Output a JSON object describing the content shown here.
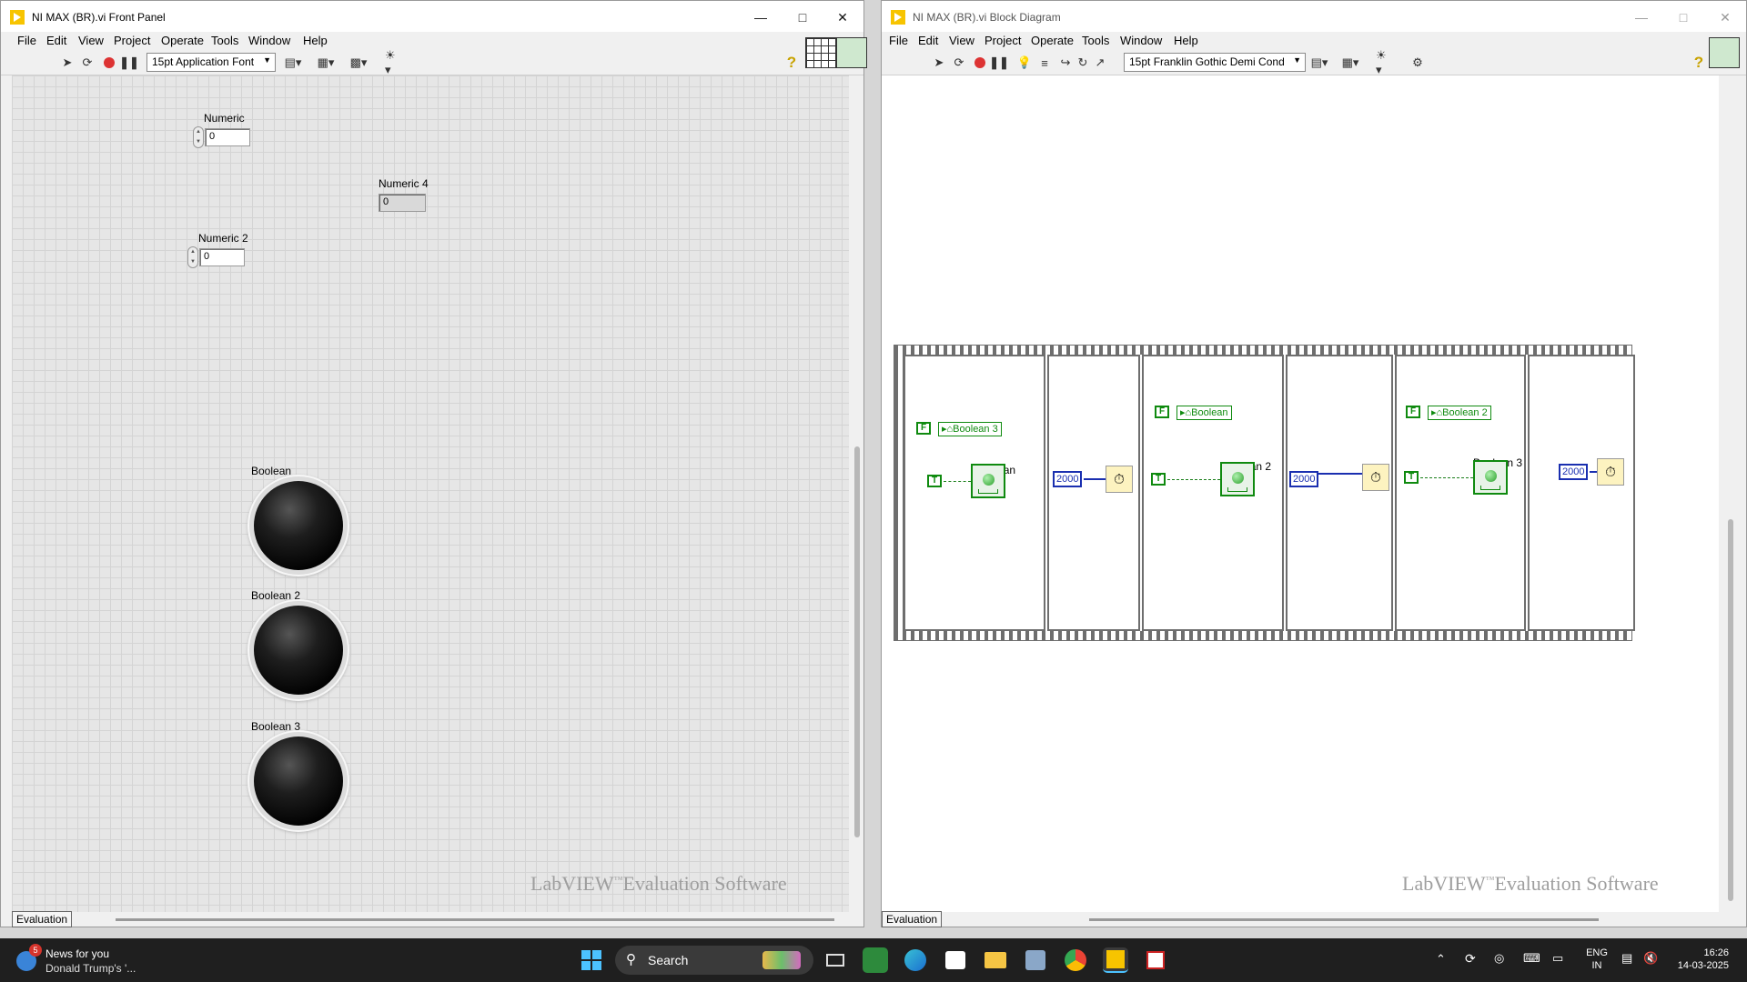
{
  "front_panel": {
    "title": "NI MAX (BR).vi Front Panel",
    "menu": [
      "File",
      "Edit",
      "View",
      "Project",
      "Operate",
      "Tools",
      "Window",
      "Help"
    ],
    "font_select": "15pt Application Font",
    "controls": [
      {
        "label": "Numeric",
        "value": "0"
      },
      {
        "label": "Numeric 2",
        "value": "0"
      }
    ],
    "indicator": {
      "label": "Numeric 4",
      "value": "0"
    },
    "leds": [
      "Boolean",
      "Boolean 2",
      "Boolean 3"
    ],
    "watermark_main": "LabVIEW",
    "watermark_tm": "™",
    "watermark_rest": "Evaluation Software",
    "eval_tab": "Evaluation"
  },
  "block_diagram": {
    "title": "NI MAX (BR).vi Block Diagram",
    "menu": [
      "File",
      "Edit",
      "View",
      "Project",
      "Operate",
      "Tools",
      "Window",
      "Help"
    ],
    "font_select": "15pt Franklin Gothic Demi Cond",
    "const_true": "T",
    "const_false": "F",
    "locals": [
      "Boolean 3",
      "Boolean",
      "Boolean 2"
    ],
    "terminals": [
      "Boolean",
      "Boolean 2",
      "Boolean 3"
    ],
    "wait_value": "2000",
    "watermark_main": "LabVIEW",
    "watermark_tm": "™",
    "watermark_rest": "Evaluation Software",
    "eval_tab": "Evaluation"
  },
  "taskbar": {
    "news_title": "News for you",
    "news_sub": "Donald Trump's '...",
    "news_badge": "5",
    "search_label": "Search",
    "lang_top": "ENG",
    "lang_bottom": "IN",
    "time": "16:26",
    "date": "14-03-2025"
  }
}
